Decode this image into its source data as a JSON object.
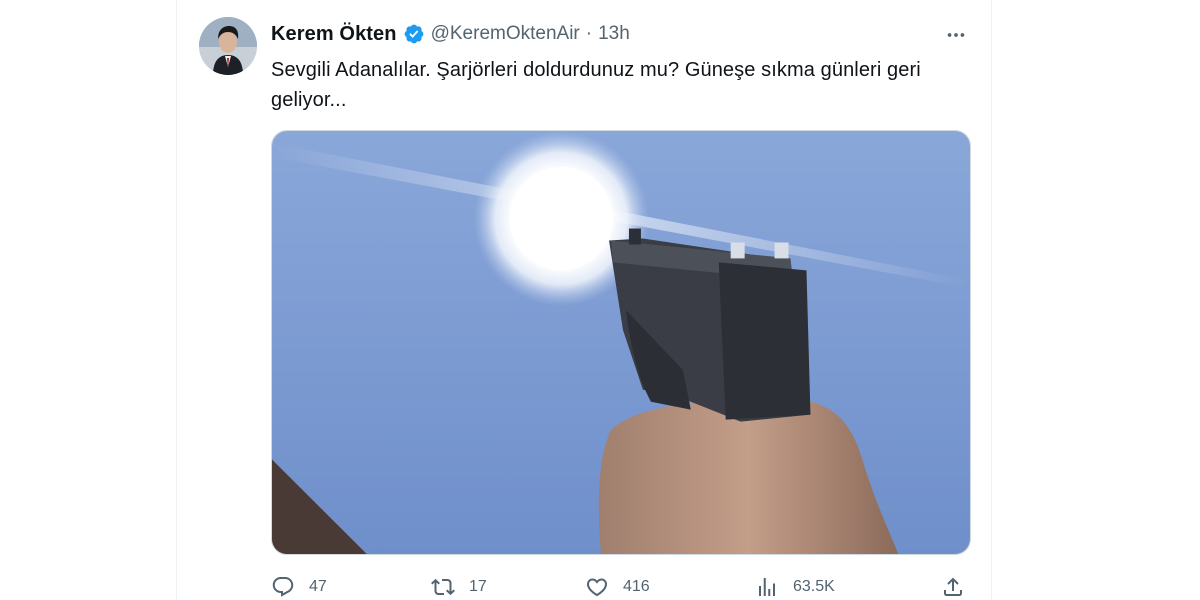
{
  "tweet": {
    "author_name": "Kerem Ökten",
    "handle": "@KeremOktenAir",
    "separator": "·",
    "time": "13h",
    "text": "Sevgili Adanalılar. Şarjörleri doldurdunuz mu? Güneşe sıkma günleri geri geliyor..."
  },
  "icons": {
    "verified": "verified-badge-icon",
    "more": "more-horizontal-icon",
    "reply": "reply-icon",
    "retweet": "retweet-icon",
    "like": "heart-icon",
    "views": "views-chart-icon",
    "share": "share-icon"
  },
  "actions": {
    "reply_count": "47",
    "retweet_count": "17",
    "like_count": "416",
    "view_count": "63.5K"
  },
  "colors": {
    "verified_blue": "#1d9bf0",
    "secondary_text": "#536471",
    "primary_text": "#0f1419"
  }
}
